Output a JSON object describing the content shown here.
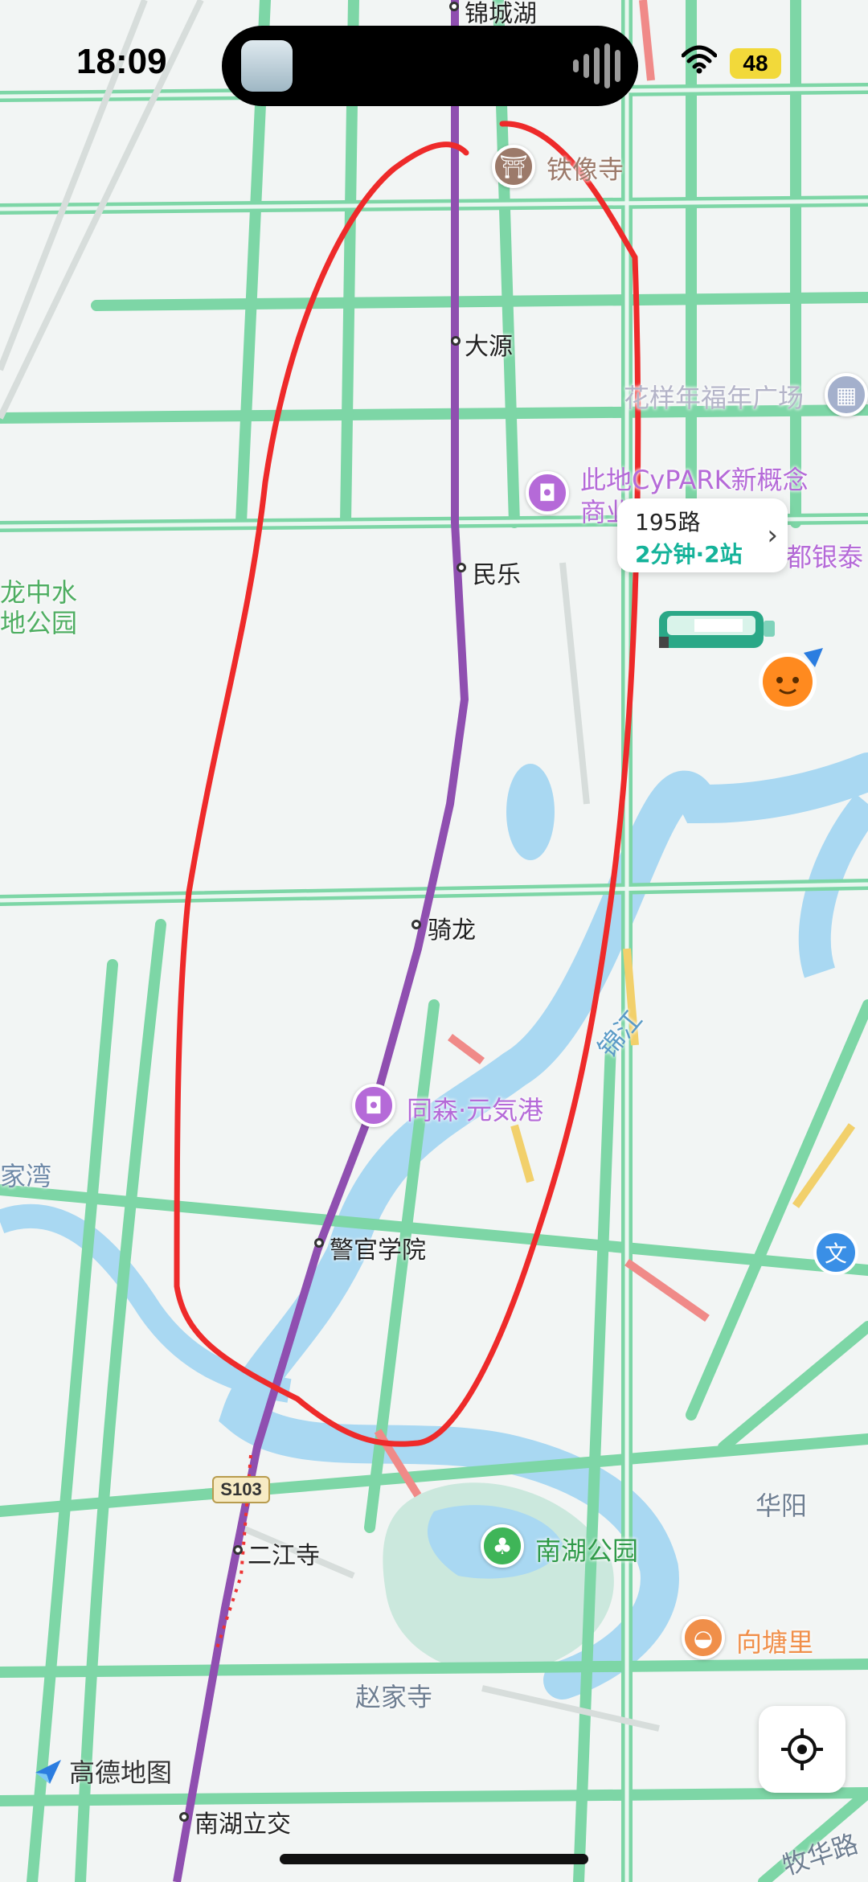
{
  "status_bar": {
    "time": "18:09",
    "battery": "48"
  },
  "map": {
    "route_color": "#8f4fb0",
    "road_color": "#7dd6a6",
    "water_color": "#a9d8f2",
    "annotation_color": "#ee2a2a",
    "stops": {
      "jinchenghu": "锦城湖",
      "dayuan": "大源",
      "minle": "民乐",
      "qilong": "骑龙",
      "jingguan": "警官学院",
      "erjiangsi": "二江寺",
      "nanhu_lijiao": "南湖立交"
    },
    "pois": {
      "tiexiangsi": "铁像寺",
      "huayang_plaza": "花样年福年广场",
      "cypark_1": "此地CyPARK新概念",
      "cypark_2": "商业",
      "dubank": "都银泰",
      "tongsen": "同森·元気港",
      "nanhu_park": "南湖公园",
      "xiangtangli": "向塘里"
    },
    "places": {
      "longzhongshui_1": "龙中水",
      "longzhongshui_2": "地公园",
      "jiawan": "家湾",
      "jinjiang": "锦江",
      "huayang": "华阳",
      "zhaojiasi": "赵家寺",
      "muhualu": "牧华路"
    },
    "road_badge": "S103",
    "wen_icon": "文"
  },
  "bus_card": {
    "route": "195路",
    "eta": "2分钟·2站"
  },
  "brand": "高德地图"
}
